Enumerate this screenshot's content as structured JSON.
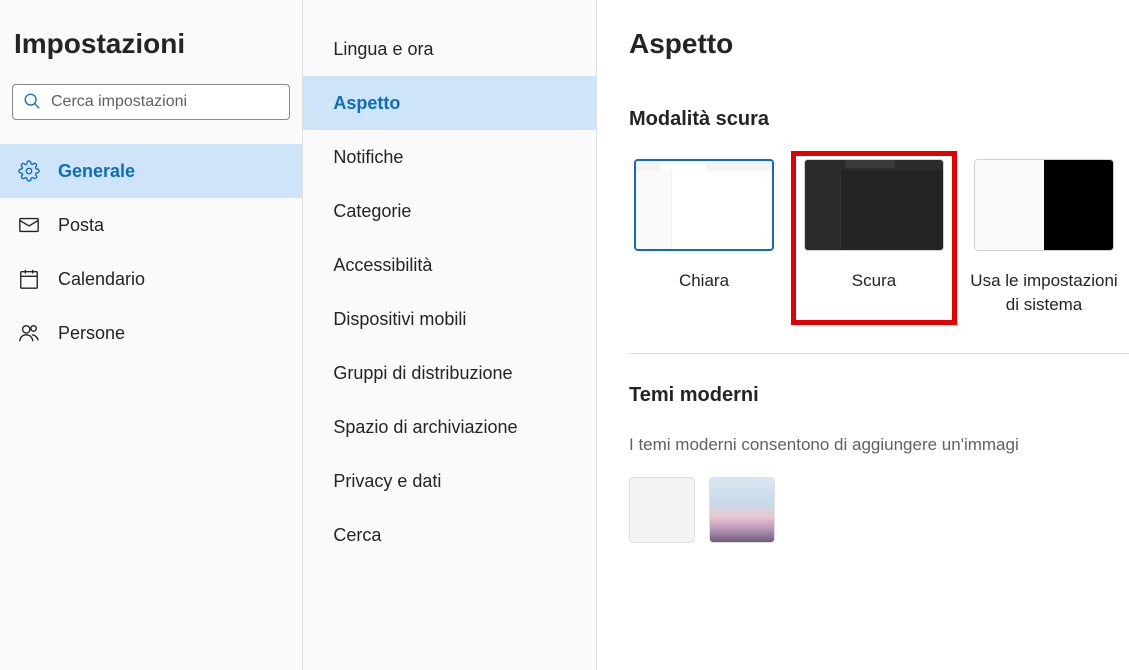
{
  "title": "Impostazioni",
  "search": {
    "placeholder": "Cerca impostazioni"
  },
  "nav1": [
    {
      "key": "generale",
      "label": "Generale",
      "icon": "gear",
      "active": true
    },
    {
      "key": "posta",
      "label": "Posta",
      "icon": "mail",
      "active": false
    },
    {
      "key": "calendario",
      "label": "Calendario",
      "icon": "calendar",
      "active": false
    },
    {
      "key": "persone",
      "label": "Persone",
      "icon": "people",
      "active": false
    }
  ],
  "nav2": [
    {
      "key": "lingua",
      "label": "Lingua e ora",
      "active": false
    },
    {
      "key": "aspetto",
      "label": "Aspetto",
      "active": true
    },
    {
      "key": "notifiche",
      "label": "Notifiche",
      "active": false
    },
    {
      "key": "categorie",
      "label": "Categorie",
      "active": false
    },
    {
      "key": "accessibilita",
      "label": "Accessibilità",
      "active": false
    },
    {
      "key": "dispositivi",
      "label": "Dispositivi mobili",
      "active": false
    },
    {
      "key": "gruppi",
      "label": "Gruppi di distribuzione",
      "active": false
    },
    {
      "key": "spazio",
      "label": "Spazio di archiviazione",
      "active": false
    },
    {
      "key": "privacy",
      "label": "Privacy e dati",
      "active": false
    },
    {
      "key": "cerca",
      "label": "Cerca",
      "active": false
    }
  ],
  "main": {
    "page_title": "Aspetto",
    "dark_mode_title": "Modalità scura",
    "modes": {
      "light": {
        "label": "Chiara"
      },
      "dark": {
        "label": "Scura"
      },
      "system": {
        "label": "Usa le impostazioni\ndi sistema"
      }
    },
    "themes_title": "Temi moderni",
    "themes_desc": "I temi moderni consentono di aggiungere un'immagi"
  },
  "colors": {
    "accent": "#0f6cbd",
    "selection": "#cee4f9",
    "highlight_box": "#e30000"
  }
}
